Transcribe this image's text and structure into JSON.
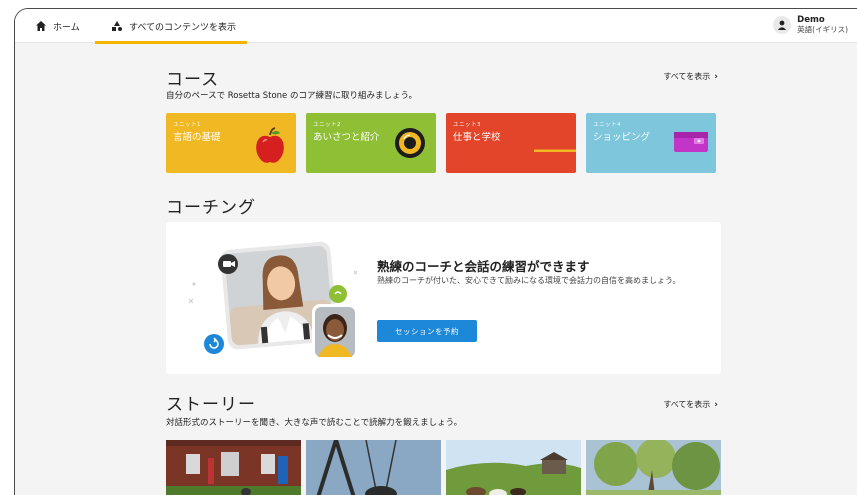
{
  "nav": {
    "home_label": "ホーム",
    "all_label": "すべてのコンテンツを表示"
  },
  "user": {
    "name": "Demo",
    "language": "英語(イギリス)"
  },
  "courses": {
    "title": "コース",
    "subtitle": "自分のペースで Rosetta Stone のコア練習に取り組みましょう。",
    "see_all": "すべてを表示",
    "units": [
      {
        "number": "ユニット1",
        "name": "言語の基礎",
        "color": "#f0b823"
      },
      {
        "number": "ユニット2",
        "name": "あいさつと紹介",
        "color": "#8fbf35"
      },
      {
        "number": "ユニット3",
        "name": "仕事と学校",
        "color": "#e2452a"
      },
      {
        "number": "ユニット4",
        "name": "ショッピング",
        "color": "#7ec6dc"
      }
    ]
  },
  "coaching": {
    "title": "コーチング",
    "heading": "熟練のコーチと会話の練習ができます",
    "description": "熟練のコーチが付いた、安心できて励みになる環境で会話力の自信を高めましょう。",
    "button": "セッションを予約"
  },
  "stories": {
    "title": "ストーリー",
    "subtitle": "対話形式のストーリーを聞き、大きな声で読むことで読解力を鍛えましょう。",
    "see_all": "すべてを表示"
  },
  "colors": {
    "accent": "#f4b400",
    "button": "#1e88d8"
  }
}
